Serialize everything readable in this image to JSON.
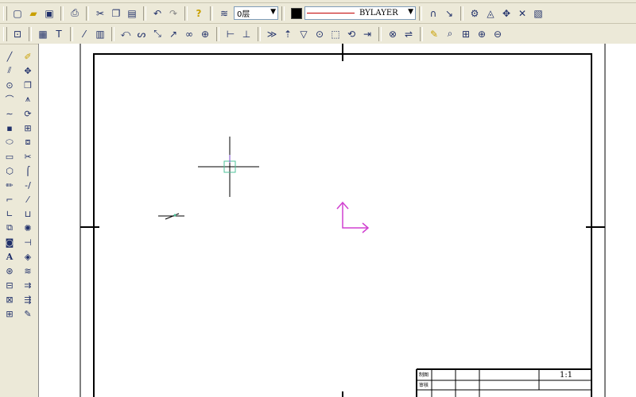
{
  "toolbar": {
    "layer_value": "0层",
    "linetype_value": "BYLAYER"
  },
  "title_block": {
    "scale": "1:1",
    "row1_label": "制图",
    "row2_label": "审核"
  },
  "colors": {
    "ucs_icon": "#d040d0",
    "crosshair_box": "#4ec29a",
    "linetype_line": "#c00000"
  },
  "icons": {
    "row1": [
      "new-icon",
      "open-icon",
      "save-icon",
      "print-icon",
      "cut-icon",
      "copy-icon",
      "paste-icon",
      "undo-icon",
      "redo-icon",
      "help-icon",
      "layers-icon"
    ],
    "row1_right": [
      "snap-icon",
      "trace-icon",
      "properties-icon",
      "zoom-window-icon",
      "tools-icon",
      "design-center-icon"
    ],
    "row2": [
      "ortho-icon",
      "grid-icon",
      "text-style-icon",
      "dim-icon",
      "osnap-icon",
      "polyline-icon",
      "spline-icon",
      "circle-icon",
      "arc-icon",
      "block-icon",
      "table-icon",
      "hatch-icon",
      "dist-icon",
      "area-icon",
      "list-icon",
      "id-icon",
      "region-icon",
      "mass-icon",
      "pan-icon",
      "zoom-icon",
      "zoom-prev-icon",
      "zoom-extents-icon",
      "zoom-all-icon",
      "zoom-in-icon"
    ],
    "left_col1": [
      "line-icon",
      "xline-icon",
      "circle-icon",
      "arc-icon",
      "spline-icon",
      "point-icon",
      "ellipse-icon",
      "rectang-icon",
      "polygon-icon",
      "pencil-icon",
      "bracket-icon",
      "dim-icon",
      "region-icon",
      "wipeout-icon",
      "text-icon",
      "block-icon",
      "insert-icon",
      "attribute-icon",
      "table-icon"
    ],
    "left_col2": [
      "eraser-icon",
      "move-icon",
      "copy-icon",
      "mirror-icon",
      "rotate-icon",
      "array-icon",
      "scale-icon",
      "trim-icon",
      "fillet-icon",
      "break-icon",
      "join-icon",
      "stretch-icon",
      "explode-icon",
      "offset-icon",
      "lengthen-icon",
      "chamfer-icon",
      "extend-icon",
      "hatch-icon",
      "match-icon"
    ]
  }
}
